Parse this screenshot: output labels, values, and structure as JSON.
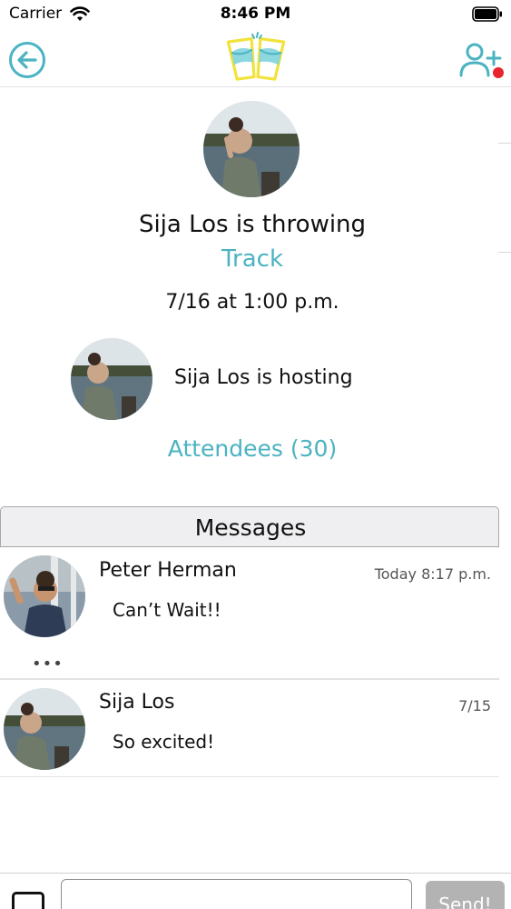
{
  "status_bar": {
    "carrier": "Carrier",
    "time": "8:46 PM",
    "wifi_icon": "wifi-icon",
    "battery_icon": "battery-full-icon"
  },
  "nav": {
    "back_icon": "arrow-left-circle-icon",
    "logo_icon": "cheers-glasses-logo",
    "add_friend_icon": "user-plus-icon",
    "notification": true
  },
  "event": {
    "throwing_text": "Sija Los is throwing",
    "event_name": "Track",
    "datetime": "7/16 at 1:00 p.m.",
    "hosting_text": "Sija Los is hosting",
    "attendees_label": "Attendees (30)"
  },
  "messages": {
    "header": "Messages",
    "items": [
      {
        "author": "Peter Herman",
        "time": "Today 8:17 p.m.",
        "text": "Can’t Wait!!",
        "more": "•••"
      },
      {
        "author": "Sija Los",
        "time": "7/15",
        "text": "So excited!"
      }
    ]
  },
  "composer": {
    "placeholder": "",
    "send_label": "Send!"
  },
  "colors": {
    "accent": "#4bb3c1",
    "logo_yellow": "#f2e23a",
    "notification": "#e8232b",
    "send_disabled": "#b3b3b3"
  }
}
